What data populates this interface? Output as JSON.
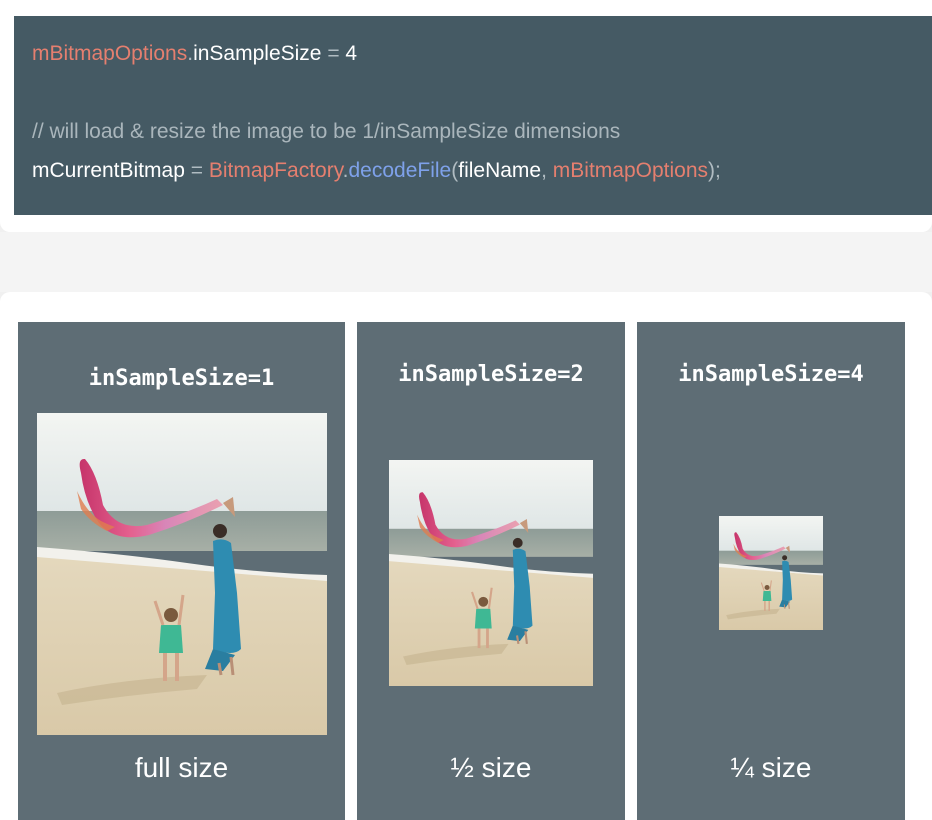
{
  "code": {
    "line1": {
      "var": "mBitmapOptions",
      "dot": ".",
      "prop": "inSampleSize",
      "op": " = ",
      "value": "4"
    },
    "line2": {
      "comment": "// will load & resize the image to be 1/inSampleSize dimensions"
    },
    "line3": {
      "target": "mCurrentBitmap",
      "op": " = ",
      "class": "BitmapFactory",
      "dot": ".",
      "method": "decodeFile",
      "open": "(",
      "arg1": "fileName",
      "comma": ", ",
      "arg2": "mBitmapOptions",
      "close": ");"
    }
  },
  "panels": [
    {
      "title": "inSampleSize=1",
      "caption": "full size"
    },
    {
      "title": "inSampleSize=2",
      "caption": "½ size"
    },
    {
      "title": "inSampleSize=4",
      "caption": "¼ size"
    }
  ],
  "colors": {
    "code_bg": "#455a64",
    "keyword_red": "#e57f6f",
    "method_blue": "#7ea1ea",
    "panel_bg": "#5e6d75"
  },
  "icons": [
    "beach-photo"
  ]
}
